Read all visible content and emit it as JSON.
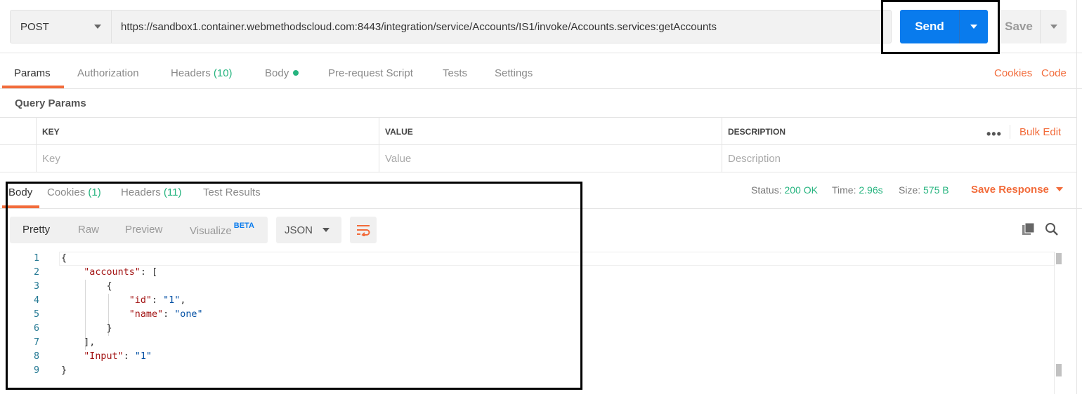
{
  "request": {
    "method": "POST",
    "url": "https://sandbox1.container.webmethodscloud.com:8443/integration/service/Accounts/IS1/invoke/Accounts.services:getAccounts",
    "send_label": "Send",
    "save_label": "Save"
  },
  "request_tabs": {
    "params": "Params",
    "authorization": "Authorization",
    "headers": "Headers",
    "headers_count": "(10)",
    "body": "Body",
    "prerequest": "Pre-request Script",
    "tests": "Tests",
    "settings": "Settings",
    "cookies": "Cookies",
    "code": "Code"
  },
  "query_params": {
    "title": "Query Params",
    "columns": [
      "KEY",
      "VALUE",
      "DESCRIPTION"
    ],
    "placeholders": [
      "Key",
      "Value",
      "Description"
    ],
    "bulk_edit": "Bulk Edit"
  },
  "response_tabs": {
    "body": "Body",
    "cookies": "Cookies",
    "cookies_count": "(1)",
    "headers": "Headers",
    "headers_count": "(11)",
    "test_results": "Test Results"
  },
  "response_status": {
    "status_label": "Status:",
    "status_value": "200 OK",
    "time_label": "Time:",
    "time_value": "2.96s",
    "size_label": "Size:",
    "size_value": "575 B",
    "save_response": "Save Response"
  },
  "response_view": {
    "pretty": "Pretty",
    "raw": "Raw",
    "preview": "Preview",
    "visualize": "Visualize",
    "beta": "BETA",
    "format": "JSON"
  },
  "response_body": {
    "line_numbers": [
      "1",
      "2",
      "3",
      "4",
      "5",
      "6",
      "7",
      "8",
      "9"
    ],
    "key_accounts": "\"accounts\"",
    "key_id": "\"id\"",
    "val_id": "\"1\"",
    "key_name": "\"name\"",
    "val_name": "\"one\"",
    "key_input": "\"Input\"",
    "val_input": "\"1\""
  },
  "colors": {
    "accent": "#f26b3a",
    "send_blue": "#097bed",
    "success_green": "#26b47f"
  }
}
